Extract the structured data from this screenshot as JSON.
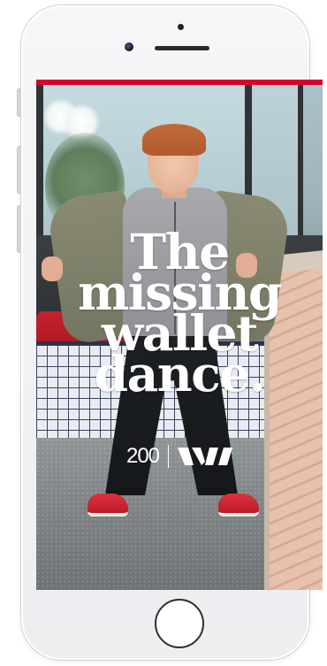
{
  "ad": {
    "headline_lines": [
      "The",
      "missing",
      "wallet",
      "dance."
    ],
    "brand_number": "200",
    "brand_logo_icon": "westpac-w-logo-icon",
    "accent_color": "#d5002b"
  },
  "device": {
    "home_button_icon": "home-button-icon",
    "camera_icon": "front-camera-icon",
    "speaker_icon": "earpiece-speaker-icon"
  }
}
